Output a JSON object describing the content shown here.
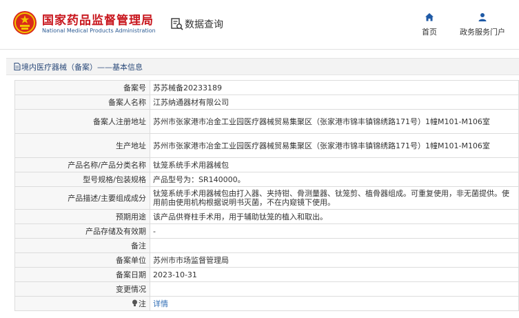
{
  "header": {
    "org_name_cn": "国家药品监督管理局",
    "org_name_en": "National Medical Products Administration",
    "data_query": "数据查询",
    "nav": [
      {
        "label": "首页",
        "icon": "home-icon"
      },
      {
        "label": "政务服务门户",
        "icon": "user-icon"
      }
    ]
  },
  "breadcrumb": "境内医疗器械（备案）——基本信息",
  "rows": [
    {
      "label": "备案号",
      "value": "苏苏械备20233189"
    },
    {
      "label": "备案人名称",
      "value": "江苏纳通器材有限公司"
    },
    {
      "label": "备案人注册地址",
      "value": "苏州市张家港市冶金工业园医疗器械贸易集聚区（张家港市锦丰镇锦绣路171号）1幢M101-M106室"
    },
    {
      "label": "生产地址",
      "value": "苏州市张家港市冶金工业园医疗器械贸易集聚区（张家港市锦丰镇锦绣路171号）1幢M101-M106室"
    },
    {
      "label": "产品名称/产品分类名称",
      "value": "钛笼系统手术用器械包"
    },
    {
      "label": "型号规格/包装规格",
      "value": "产品型号为：SR140000。"
    },
    {
      "label": "产品描述/主要组成成分",
      "value": "钛笼系统手术用器械包由打入器、夹持钳、骨测量器、钛笼剪、植骨器组成。可重复使用，非无菌提供。使用前由使用机构根据说明书灭菌，不在内窥镜下使用。"
    },
    {
      "label": "预期用途",
      "value": "该产品供脊柱手术用，用于辅助钛笼的植入和取出。"
    },
    {
      "label": "产品存储及有效期",
      "value": "-"
    },
    {
      "label": "备注",
      "value": ""
    },
    {
      "label": "备案单位",
      "value": "苏州市市场监督管理局"
    },
    {
      "label": "备案日期",
      "value": "2023-10-31"
    },
    {
      "label": "变更情况",
      "value": ""
    },
    {
      "label": "注",
      "value": "详情",
      "icon": "lightbulb-icon"
    }
  ],
  "colors": {
    "brand_red": "#c8161d",
    "brand_blue": "#2b5a93",
    "link": "#2f6db5"
  }
}
